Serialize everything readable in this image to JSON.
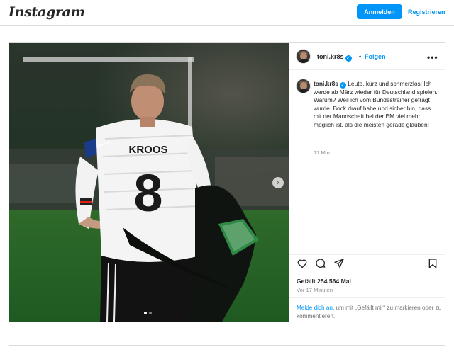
{
  "header": {
    "logo_text": "Instagram",
    "login_label": "Anmelden",
    "register_label": "Registrieren"
  },
  "post": {
    "image": {
      "jersey_name": "KROOS",
      "jersey_number": "8",
      "captain_band": "CAPTAIN",
      "slide_count": 2,
      "active_slide": 1
    },
    "author": {
      "username": "toni.kr8s",
      "separator": "•",
      "follow_label": "Folgen",
      "more_label": "•••"
    },
    "caption": {
      "username": "toni.kr8s",
      "text": "Leute, kurz und schmerzlos: Ich werde ab März wieder für Deutschland spielen. Warum? Weil ich vom Bundestrainer gefragt wurde. Bock drauf habe und sicher bin, dass mit der Mannschaft bei der EM viel mehr möglich ist, als die meisten gerade glauben!",
      "time": "17 Min."
    },
    "likes": "Gefällt 254.564 Mal",
    "time_ago": "Vor 17 Minuten",
    "login_prompt": {
      "link": "Melde dich an,",
      "text": " um mit „Gefällt mir“ zu markieren oder zu kommentieren."
    }
  },
  "icons": {
    "like": "heart-icon",
    "comment": "comment-icon",
    "share": "share-icon",
    "save": "bookmark-icon",
    "next": "chevron-right-icon"
  },
  "colors": {
    "accent": "#0095f6",
    "text": "#262626",
    "muted": "#8e8e8e",
    "border": "#dbdbdb"
  }
}
